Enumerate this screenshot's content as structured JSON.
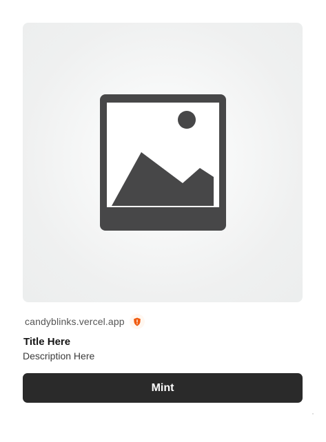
{
  "card": {
    "domain": "candyblinks.vercel.app",
    "title": "Title Here",
    "description": "Description Here",
    "button_label": "Mint"
  },
  "icons": {
    "image_placeholder": "image-placeholder-icon",
    "warning": "warning-shield-icon"
  },
  "colors": {
    "button": "#2a2a2a",
    "warning_badge": "#f05a0e",
    "placeholder_icon": "#474748",
    "image_background": "#eff0f0"
  }
}
